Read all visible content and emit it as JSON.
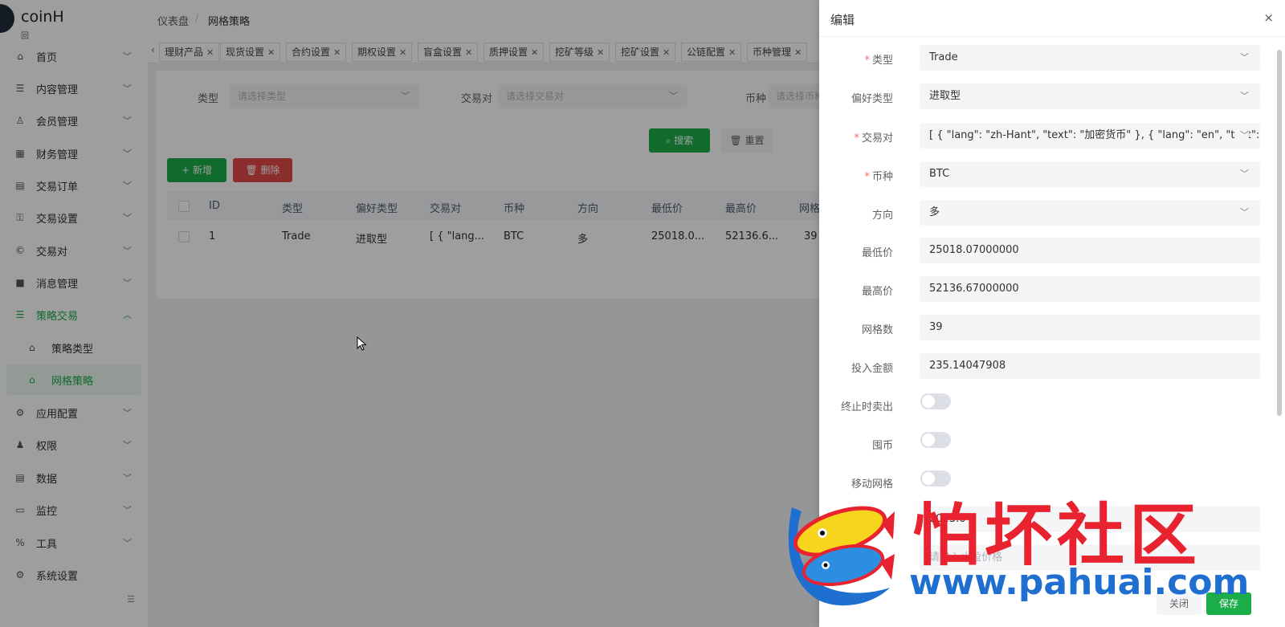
{
  "brand": {
    "name": "coinH",
    "sub": "回"
  },
  "sidebar": {
    "items": [
      {
        "label": "首页",
        "icon": "home-icon"
      },
      {
        "label": "内容管理",
        "icon": "list-icon"
      },
      {
        "label": "会员管理",
        "icon": "user-icon"
      },
      {
        "label": "财务管理",
        "icon": "table-icon"
      },
      {
        "label": "交易订单",
        "icon": "order-icon"
      },
      {
        "label": "交易设置",
        "icon": "key-icon"
      },
      {
        "label": "交易对",
        "icon": "copyright-icon"
      },
      {
        "label": "消息管理",
        "icon": "message-icon"
      },
      {
        "label": "策略交易",
        "icon": "strategy-icon"
      },
      {
        "label": "应用配置",
        "icon": "app-config-icon"
      },
      {
        "label": "权限",
        "icon": "permission-icon"
      },
      {
        "label": "数据",
        "icon": "data-icon"
      },
      {
        "label": "监控",
        "icon": "monitor-icon"
      },
      {
        "label": "工具",
        "icon": "tools-icon"
      },
      {
        "label": "系统设置",
        "icon": "gear-icon"
      }
    ],
    "sub_items": [
      {
        "label": "策略类型",
        "icon": "home-icon"
      },
      {
        "label": "网格策略",
        "icon": "home-icon"
      }
    ]
  },
  "header": {
    "breadcrumb": [
      "仪表盘",
      "/",
      "网格策略"
    ]
  },
  "tags": [
    "理财产品",
    "现货设置",
    "合约设置",
    "期权设置",
    "盲盒设置",
    "质押设置",
    "挖矿等级",
    "挖矿设置",
    "公链配置",
    "币种管理"
  ],
  "filters": {
    "type_label": "类型",
    "type_placeholder": "请选择类型",
    "pair_label": "交易对",
    "pair_placeholder": "请选择交易对",
    "coin_label": "币种",
    "coin_placeholder": "请选择币种",
    "search_label": "搜索",
    "reset_label": "重置"
  },
  "actions": {
    "add_label": "新增",
    "delete_label": "删除"
  },
  "table": {
    "columns": [
      "ID",
      "类型",
      "偏好类型",
      "交易对",
      "币种",
      "方向",
      "最低价",
      "最高价",
      "网格"
    ],
    "rows": [
      [
        "1",
        "Trade",
        "进取型",
        "[ { \"lang...",
        "BTC",
        "多",
        "25018.0...",
        "52136.6...",
        "39"
      ]
    ]
  },
  "drawer": {
    "title": "编辑",
    "close": "×",
    "fields": {
      "type": {
        "label": "类型",
        "value": "Trade"
      },
      "preference": {
        "label": "偏好类型",
        "value": "进取型"
      },
      "pair": {
        "label": "交易对",
        "value": "[ { \"lang\": \"zh-Hant\", \"text\": \"加密货币\" }, { \"lang\": \"en\", \"text\": "
      },
      "coin": {
        "label": "币种",
        "value": "BTC"
      },
      "direction": {
        "label": "方向",
        "value": "多"
      },
      "min_price": {
        "label": "最低价",
        "value": "25018.07000000"
      },
      "max_price": {
        "label": "最高价",
        "value": "52136.67000000"
      },
      "grid_count": {
        "label": "网格数",
        "value": "39"
      },
      "amount": {
        "label": "投入金额",
        "value": "235.14047908"
      },
      "sell_on_stop": {
        "label": "终止时卖出",
        "on": false
      },
      "hoard": {
        "label": "囤币",
        "on": false
      },
      "move_grid": {
        "label": "移动网格",
        "on": false
      },
      "next_value": "2023.0",
      "next_placeholder": "请输入止盈价格"
    },
    "footer": {
      "cancel": "关闭",
      "save": "保存"
    }
  },
  "watermark": {
    "text": "怕坏社区",
    "url": "www.pahuai.com"
  },
  "colors": {
    "accent": "#1aad4a",
    "danger": "#e04a4a",
    "required": "#f56c6c"
  }
}
